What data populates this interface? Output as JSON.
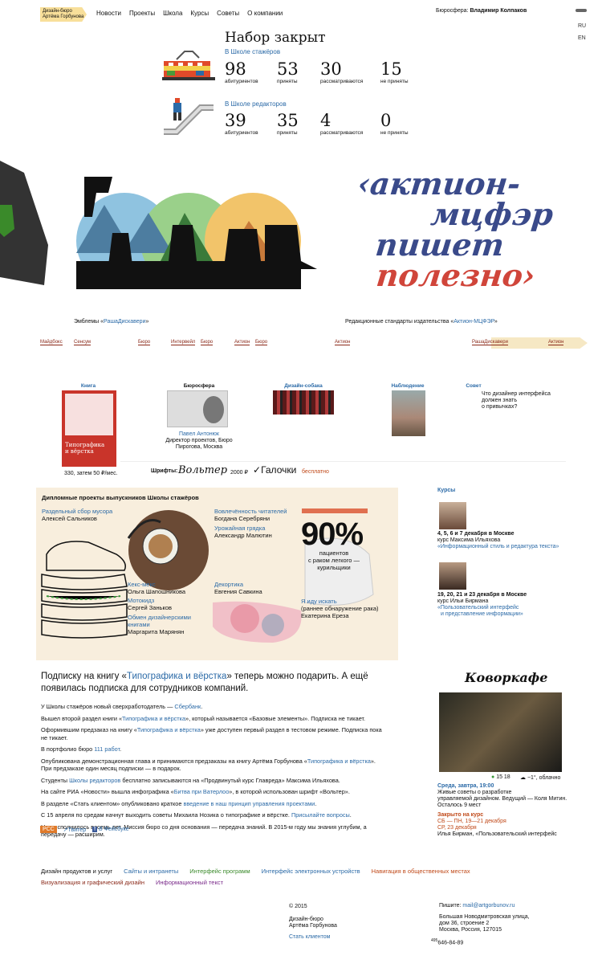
{
  "header": {
    "logo_line1": "Дизайн-бюро",
    "logo_line2": "Артёма Горбунова",
    "nav": [
      "Новости",
      "Проекты",
      "Школа",
      "Курсы",
      "Советы",
      "О компании"
    ],
    "bureau_label": "Бюросфера:",
    "bureau_name": "Владимир Колпаков",
    "lang_ru": "RU",
    "lang_en": "EN"
  },
  "admissions": {
    "title": "Набор закрыт",
    "school1": "В Школе стажёров",
    "s1": [
      "98",
      "53",
      "30",
      "15"
    ],
    "school2": "В Школе редакторов",
    "s2": [
      "39",
      "35",
      "4",
      "0"
    ],
    "labels": [
      "абитуриентов",
      "приняты",
      "рассматриваются",
      "не приняты"
    ]
  },
  "banner": {
    "left_caption_prefix": "Эмблемы «",
    "left_caption_link": "РашаДискавери",
    "left_caption_suffix": "»",
    "right_caption_prefix": "Редакционные стандарты издательства «",
    "right_caption_link": "Актион-МЦФЭР",
    "right_caption_suffix": "»",
    "lettering": [
      "‹актион-",
      "мцфэр",
      "пишет",
      "полезно›"
    ],
    "emblem_text": "Раша Дискавери"
  },
  "strip": [
    "Майдбокс",
    "Сенсум",
    "Бюро",
    "Интервейл",
    "Бюро",
    "Актион",
    "Бюро",
    "Актион",
    "РашаДискавери",
    "Актион"
  ],
  "cards": {
    "book": {
      "title": "Книга",
      "cover1": "Типографика",
      "cover2": "и вёрстка",
      "price": "330, затем 50 ₽/мес."
    },
    "sphere": {
      "title": "Бюросфера",
      "name": "Павел Антонюк",
      "role1": "Директор проектов, Бюро",
      "role2": "Пирогова, Москва"
    },
    "dog": {
      "title": "Дизайн-собака"
    },
    "obs": {
      "title": "Наблюдение"
    },
    "advice": {
      "title": "Совет",
      "text1": "Что дизайнер интерфейса",
      "text2": "должен знать",
      "text3": "о привычках?"
    },
    "fonts_label": "Шрифты:",
    "font1": "Вольтер",
    "font1_price": "2000 ₽",
    "font2": "Галочки",
    "font2_price": "бесплатно"
  },
  "diploma": {
    "title": "Дипломные проекты выпускников Школы стажёров",
    "items": [
      {
        "p": "Раздельный сбор мусора",
        "a": "Алексей Сальников"
      },
      {
        "p": "Вовлечённость читателей",
        "a": "Богдана Серебряни"
      },
      {
        "p": "Урожайная грядка",
        "a": "Александр Малютин"
      },
      {
        "p": "Кекс-мекс",
        "a": "Ольга Шапошникова"
      },
      {
        "p": "Мотокидз",
        "a": "Сергей Заньков"
      },
      {
        "p": "Обмен дизайнерскими книгами",
        "a": "Маргарита Марянян"
      },
      {
        "p": "Декортика",
        "a": "Евгения Савкина"
      },
      {
        "p": "Я иду искать",
        "a": "(раннее обнаружение рака)"
      }
    ],
    "author8": "Екатерина Ереза",
    "pct": "90%",
    "pct_text1": "пациентов",
    "pct_text2": "с раком легкого —",
    "pct_text3": "курильщики"
  },
  "courses": {
    "title": "Курсы",
    "c1_date": "4, 5, 6 и 7 декабря в Москве",
    "c1_teacher": "курс Максима Ильяхова",
    "c1_name": "«Информационный стиль и редактура текста»",
    "c2_date": "19, 20, 21 и 23 декабря в Москве",
    "c2_teacher": "курс Ильи Бирмана",
    "c2_name1": "«Пользовательский интерфейс",
    "c2_name2": "и представление информации»"
  },
  "cafe": {
    "title": "Коворкафе",
    "time": "15 18",
    "weather": "−1°, облачно",
    "event_date": "Среда, завтра, 19:00",
    "event1": "Живые советы о разработке",
    "event2": "управляемой дизайном. Ведущий — Коля Митин.",
    "event3": "Осталось 9 мест",
    "closed": "Закрыто на курс",
    "closed1": "СБ — ПН, 19—21 декабря",
    "closed2": "СР, 23 декабря",
    "closed3": "Илья Бирман, «Пользовательский интерфейс"
  },
  "subscription": {
    "pre": "Подписку на книгу «",
    "link": "Типографика и вёрстка",
    "post": "» теперь можно подарить. А ещё появилась подписка для сотрудников компаний."
  },
  "news": [
    {
      "pre": "У Школы стажёров новый сверхработодатель — ",
      "link": "Сбербанк",
      "post": "."
    },
    {
      "pre": "Вышел второй раздел книги «",
      "link": "Типографика и вёрстка",
      "post": "», который называется «Базовые элементы». Подписка не тикает."
    },
    {
      "pre": "Оформившим предзаказ на книгу «",
      "link": "Типографика и вёрстка",
      "post": "» уже доступен первый раздел в тестовом режиме. Подписка пока не тикает."
    },
    {
      "pre": "В портфолио бюро ",
      "link": "111 работ",
      "post": "."
    },
    {
      "pre": "Опубликована демонстрационная глава и принимаются предзаказы на книгу Артёма Горбунова «",
      "link": "Типографика и вёрстка",
      "post": "». При предзаказе один месяц подписки — в подарок."
    },
    {
      "pre": "Студенты ",
      "link": "Школы редакторов",
      "post": " бесплатно записываются на «Продвинутый курс Главреда» Максима Ильяхова."
    },
    {
      "pre": "На сайте РИА «Новости» вышла инфографика «",
      "link": "Битва при Ватерлоо",
      "post": "», в которой использован шрифт «Вольтер»."
    },
    {
      "pre": "В разделе «Стать клиентом» опубликовано краткое ",
      "link": "введение в наш принцип управления проектами",
      "post": "."
    },
    {
      "pre": "С 15 апреля по средам начнут выходить советы Михаила Нозика о типографике и вёрстке. ",
      "link": "Присылайте вопросы",
      "post": "."
    },
    {
      "pre": "Нам исполнилось восемь лет. Миссия бюро со дня основания — передача знаний. В 2015-м году мы знания углубим, а передачу — расширим.",
      "link": "",
      "post": ""
    }
  ],
  "social": {
    "rss": "РСС",
    "twitter": "Твитер",
    "facebook": "В Фейсбуке"
  },
  "footer_nav": [
    {
      "t": "Дизайн продуктов и услуг",
      "c": "#111"
    },
    {
      "t": "Сайты и интранеты",
      "c": "#2b6aa7"
    },
    {
      "t": "Интерфейс программ",
      "c": "#3a8a2a"
    },
    {
      "t": "Интерфейс электронных устройств",
      "c": "#2b6aa7"
    },
    {
      "t": "Навигация в общественных местах",
      "c": "#c04a1a"
    },
    {
      "t": "Визуализация и графический дизайн",
      "c": "#8b2a1a"
    },
    {
      "t": "Информационный текст",
      "c": "#7a2a8a"
    }
  ],
  "footer": {
    "copy": "© 2015",
    "org1": "Дизайн-бюро",
    "org2": "Артёма Горбунова",
    "client": "Стать клиентом",
    "write": "Пишите:",
    "email": "mail@artgorbunov.ru",
    "addr1": "Большая Новодмитровская улица,",
    "addr2": "дом 36, строение 2",
    "addr3": "Москва, Россия, 127015",
    "phone_code": "495",
    "phone": "646-84-89"
  }
}
